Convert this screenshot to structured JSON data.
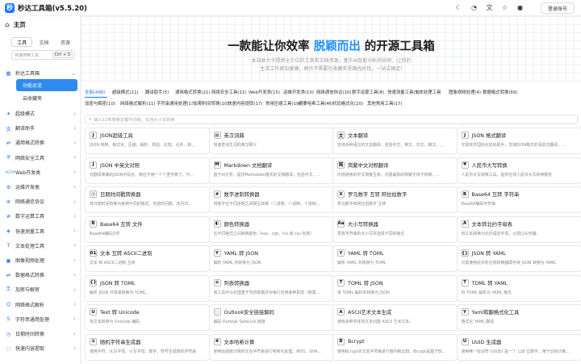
{
  "app": {
    "title": "秒达工具箱(v5.5.20)",
    "logo_char": "秒",
    "login_label": "登录账号"
  },
  "top_icons": [
    "moon-icon",
    "paint-icon",
    "translate-icon",
    "star-icon",
    "github-icon"
  ],
  "sidebar": {
    "home_label": "主页",
    "tabs": [
      {
        "label": "工具",
        "active": true
      },
      {
        "label": "文档",
        "active": false
      },
      {
        "label": "资源",
        "active": false
      }
    ],
    "search_placeholder": "快速搜索工具",
    "search_shortcut": "Ctrl + S",
    "section_label": "秒达工具箱",
    "sub_items": [
      {
        "label": "功能总览",
        "active": true
      },
      {
        "label": "云收藏夹",
        "active": false
      }
    ],
    "items": [
      {
        "label": "超级模式",
        "icon": "✦"
      },
      {
        "label": "翻译助手",
        "icon": "文"
      },
      {
        "label": "通用格式转换",
        "icon": "⇄"
      },
      {
        "label": "网络安全工具",
        "icon": "⛨"
      },
      {
        "label": "Web开发类",
        "icon": "</>"
      },
      {
        "label": "运维开发类",
        "icon": "⚙"
      },
      {
        "label": "网络通信协议",
        "icon": "⊕"
      },
      {
        "label": "数字运算工具",
        "icon": "#"
      },
      {
        "label": "快速测量工具",
        "icon": "◈"
      },
      {
        "label": "文本处理工具",
        "icon": "T"
      },
      {
        "label": "图像视频处理",
        "icon": "▣"
      },
      {
        "label": "数据格式转换",
        "icon": "⇌"
      },
      {
        "label": "加密与解密",
        "icon": "⚿"
      },
      {
        "label": "网络格式解析",
        "icon": "⌬"
      },
      {
        "label": "字符串通用处理",
        "icon": "S"
      },
      {
        "label": "日期时间转换",
        "icon": "◷"
      },
      {
        "label": "快速内容提取",
        "icon": "⬚"
      }
    ]
  },
  "hero": {
    "headline_before": "一款能让你效率 ",
    "headline_highlight": "脱颖而出",
    "headline_after": " 的开源工具箱",
    "line1": "本站致力于提供全方位的工具和文档资源，基于AI智能分析的协同，让你的",
    "line2": "生活工作更加便捷。再也不需要在收藏夹里面找好找，一站式搞定!"
  },
  "category_tabs": [
    {
      "label": "全部(498)",
      "active": true
    },
    {
      "label": "超级模式(11)"
    },
    {
      "label": "翻译助手(5)"
    },
    {
      "label": "通用格式转换(21)"
    },
    {
      "label": "网络安全工具(11)"
    },
    {
      "label": "Web开发类(15)"
    },
    {
      "label": "运维开发类(10)"
    },
    {
      "label": "网络通信协议(10)"
    },
    {
      "label": "数字运算工具(8)"
    },
    {
      "label": "快速测量工具(5)"
    },
    {
      "label": "文本处理工具"
    },
    {
      "label": "图像视频处理(4)"
    },
    {
      "label": "数据格式转换(69)"
    },
    {
      "label": "加密与解密(10)"
    },
    {
      "label": "网络格式解析(11)"
    },
    {
      "label": "字符串通用处理(17)"
    },
    {
      "label": "日期时间转换(10)"
    },
    {
      "label": "快速内容提取(17)"
    },
    {
      "label": "常用压缩工具(19)"
    },
    {
      "label": "摘要哈希工具(46)"
    },
    {
      "label": "代码格式化(20)"
    },
    {
      "label": "其他常用工具(17)"
    }
  ],
  "filter_placeholder": "输入12条搜索关键字词组，支持大小写转换",
  "cards": [
    {
      "title": "JSON超级工具",
      "desc": "JSON 转换、格式化、压缩、解析、校验、比较、合并、转...",
      "icon": "JSON"
    },
    {
      "title": "英汉词典",
      "desc": "快速查询生词的英汉释义",
      "icon": "▤"
    },
    {
      "title": "文本翻译",
      "desc": "支持多种语言的文本翻译，包括中文、英文、日文、韩文、...",
      "icon": "文"
    },
    {
      "title": "JSON 格式翻译",
      "desc": "实现软件国际化的好助手，支持JSON格式的深层次翻译，...",
      "icon": "JSON"
    },
    {
      "title": "JSON 中英文对照",
      "desc": "对翻译准确的JSON字段名、两位不用一个个查字典了、可...",
      "icon": "JSON"
    },
    {
      "title": "Markdown 文档翻译",
      "desc": "基于AI分析，提供Markdown格式的文档翻译，包括中文、...",
      "icon": "M"
    },
    {
      "title": "简繁中文对照翻译",
      "desc": "内地通用的中文简繁互转，内置最新的简繁字体不依赖，...",
      "icon": "简"
    },
    {
      "title": "人民币大写转换",
      "desc": "人民币大写转换工具，提供在线人民币大写转换服务",
      "icon": "¥"
    },
    {
      "title": "日期时间戳转换器",
      "desc": "将日期时间转换为各种不同的格式，包括时间戳、年月日...",
      "icon": "◷"
    },
    {
      "title": "数字进制转换器",
      "desc": "将数字在不同进制之间相互转换（二进制、八进制、十进制...",
      "icon": "#"
    },
    {
      "title": "罗马数字 互转 阿拉伯数字",
      "desc": "罗马数字和阿拉伯数字 互转",
      "icon": "X"
    },
    {
      "title": "Base64 互转 字符串",
      "desc": "Base64编码字符串",
      "icon": "B"
    },
    {
      "title": "Base64 互转 文件",
      "desc": "Base64编码文件",
      "icon": "B"
    },
    {
      "title": "颜色转换器",
      "desc": "在不同格式之间转换颜色（hex、rgb、hsl 和 css 名称）",
      "icon": "◐"
    },
    {
      "title": "大小写转换器",
      "desc": "更改字符串的大小写并选择不同的格式",
      "icon": "Aa"
    },
    {
      "title": "文本转北约字母表",
      "desc": "将文本转换为北约语音字母，以便口头传播。",
      "icon": "A"
    },
    {
      "title": "文本 互转 ASCII二进制",
      "desc": "文本 和 ASCII二进制 互转",
      "icon": "01"
    },
    {
      "title": "YAML 转 JSON",
      "desc": "解析 YAML 并转换为 JSON",
      "icon": "Y"
    },
    {
      "title": "YAML 转 TOML",
      "desc": "解析 YAML 并转换为 TOML",
      "icon": "Y"
    },
    {
      "title": "JSON 转 YAML",
      "desc": "只需使用此实时在线转换器即可将 JSON 转换为 YAML",
      "icon": "{}"
    },
    {
      "title": "JSON 转 TOML",
      "desc": "解析 JSON 并将其转换为 TOML。",
      "icon": "{}"
    },
    {
      "title": "列表转换器",
      "desc": "该工具可以处理基于列的数据并对每行应用各种更改（转置...",
      "icon": "≡"
    },
    {
      "title": "TOML 转 JSON",
      "desc": "将 TOML 解析并转换为 JSON",
      "icon": "T"
    },
    {
      "title": "TOML 转 YAML",
      "desc": "将 TOML 解析为 YAML 格式",
      "icon": "T"
    },
    {
      "title": "Text 转 Unicode",
      "desc": "将文本转换为 Unicode 编码",
      "icon": "U"
    },
    {
      "title": "Outlook安全链接解码",
      "desc": "解码 Outlook SafeLink 链接",
      "icon": "◌"
    },
    {
      "title": "ASCII艺术文本生成",
      "desc": "使用多种字体将文本创建 ASCII 艺术文本。",
      "icon": "A"
    },
    {
      "title": "Yaml和翻格式化工具",
      "desc": "格式化 YAML 翻译",
      "icon": "Y"
    },
    {
      "title": "随机字符串生成器",
      "desc": "使用字符、大写字母、小写字母、数字、符号生成随机字符串",
      "icon": "≋"
    },
    {
      "title": "文本哈希计算",
      "desc": "使用此函数计算的文本字符串进行哈希化处理，MD5、SHA...",
      "icon": "#"
    },
    {
      "title": "Bcrypt",
      "desc": "使用Bcrypt对文本字符串进行散列和比较，Bcrypt是基于Bl...",
      "icon": "B"
    },
    {
      "title": "UUID 生成器",
      "desc": "通用唯一标识符 (UUID) 是一个 128 位数字，用于识别计算...",
      "icon": "U"
    }
  ]
}
